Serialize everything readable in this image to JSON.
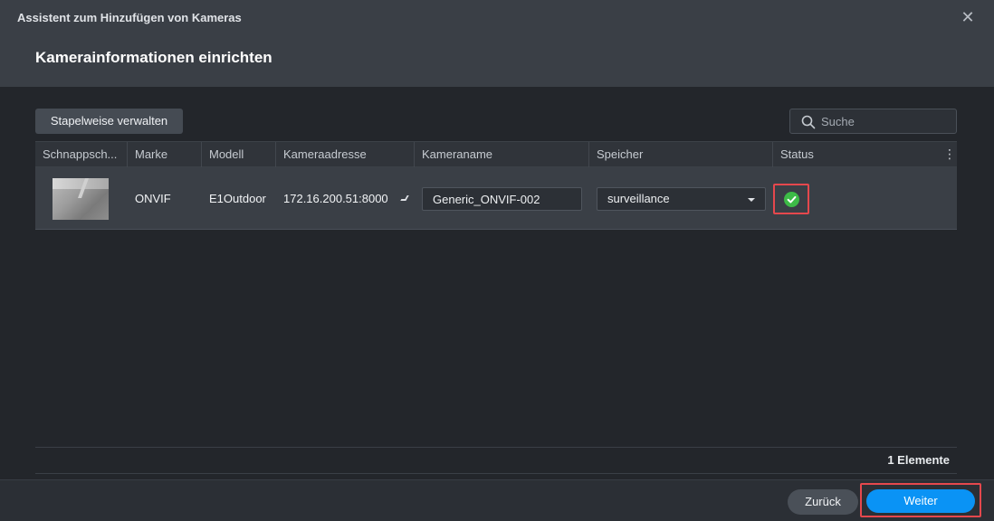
{
  "window": {
    "title": "Assistent zum Hinzufügen von Kameras",
    "close_symbol": "✕"
  },
  "page": {
    "title": "Kamerainformationen einrichten"
  },
  "toolbar": {
    "batch_label": "Stapelweise verwalten",
    "search_placeholder": "Suche"
  },
  "table": {
    "columns": [
      "Schnappsch...",
      "Marke",
      "Modell",
      "Kameraadresse",
      "Kameraname",
      "Speicher",
      "Status"
    ],
    "menu_symbol": "⋮",
    "rows": [
      {
        "brand": "ONVIF",
        "model": "E1Outdoor",
        "address": "172.16.200.51:8000",
        "name": "Generic_ONVIF-002",
        "storage": "surveillance",
        "status_icon": "check-circle-icon",
        "status_color": "#3dbb47"
      }
    ]
  },
  "footer": {
    "count_label": "1 Elemente",
    "back_label": "Zurück",
    "next_label": "Weiter"
  },
  "colors": {
    "accent": "#0a93f5",
    "highlight": "#e5484d",
    "success": "#3dbb47"
  }
}
